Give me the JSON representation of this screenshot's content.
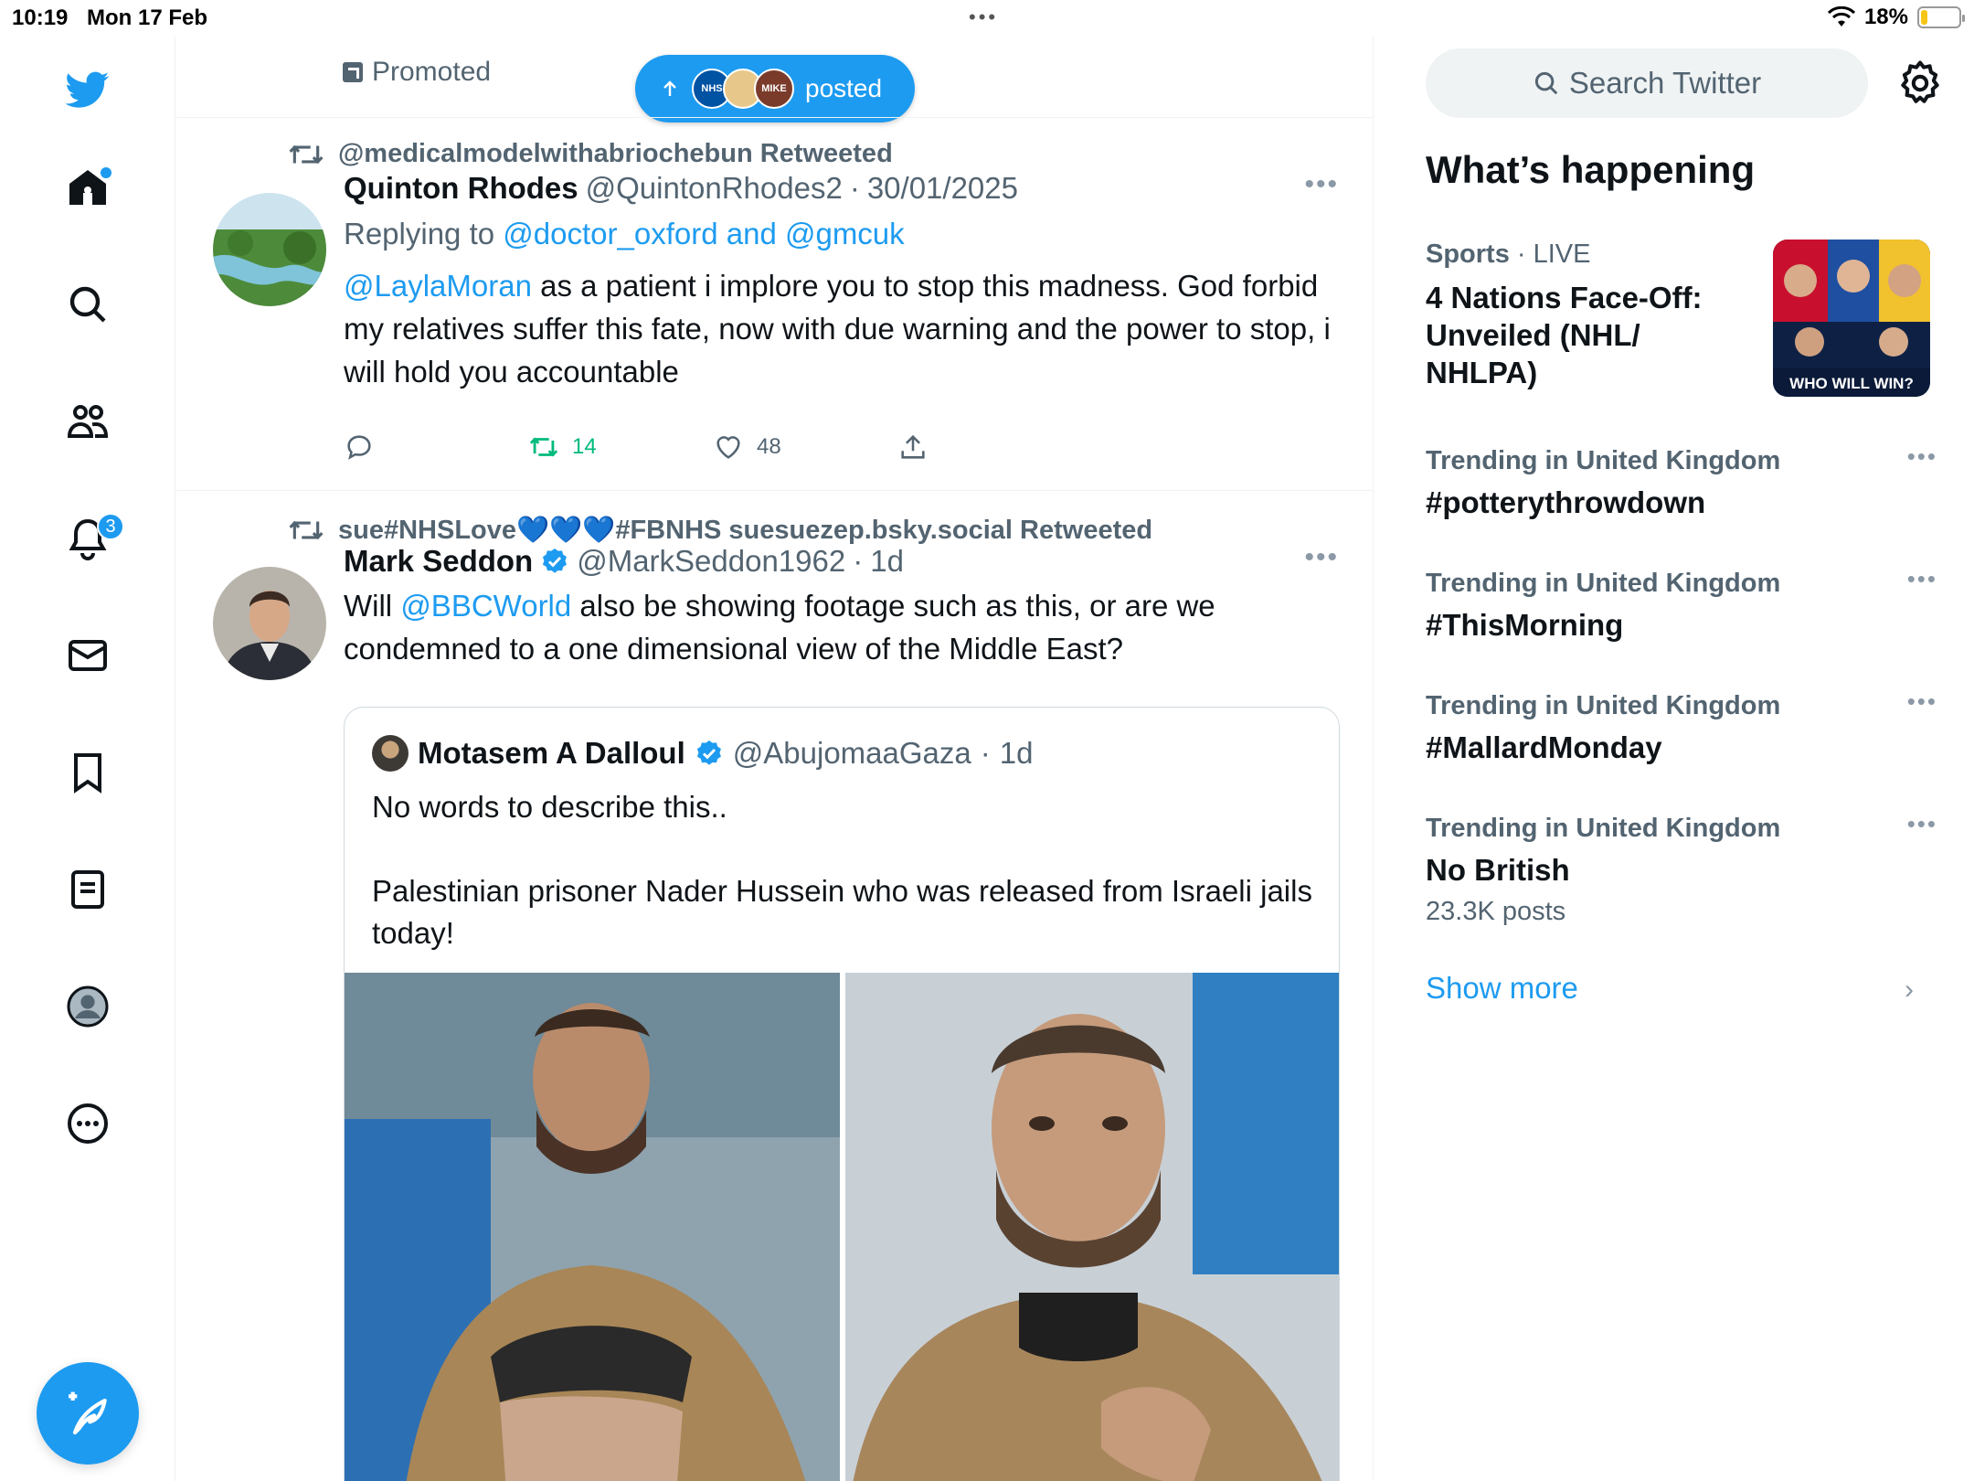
{
  "status_bar": {
    "time": "10:19",
    "date": "Mon 17 Feb",
    "battery": "18%",
    "battery_level": 0.18
  },
  "nav": {
    "notifications_badge": "3",
    "items": [
      "home-icon",
      "search-icon",
      "communities-icon",
      "notifications-icon",
      "messages-icon",
      "bookmarks-icon",
      "lists-icon",
      "profile-icon",
      "more-icon"
    ]
  },
  "timeline": {
    "promoted_label": "Promoted",
    "new_posts_pill": {
      "label": "posted",
      "avatar_labels": [
        "NHS",
        "",
        "MIKE"
      ]
    },
    "tweets": [
      {
        "retweeted_by": "@medicalmodelwithabriochebun Retweeted",
        "name": "Quinton Rhodes",
        "handle": "@QuintonRhodes2",
        "dot": "·",
        "date": "30/01/2025",
        "replying_prefix": "Replying to",
        "replying_to": "@doctor_oxford and @gmcuk",
        "mention": "@LaylaMoran",
        "text": " as a patient i implore you to stop this madness. God forbid my relatives suffer this fate, now with due warning and the power to stop, i will hold you accountable",
        "retweets": "14",
        "likes": "48"
      },
      {
        "retweeted_by": "sue#NHSLove💙💙💙#FBNHS suesuezep.bsky.social Retweeted",
        "name": "Mark Seddon",
        "handle": "@MarkSeddon1962",
        "dot": "·",
        "date": "1d",
        "text_prefix": "Will ",
        "mention": "@BBCWorld",
        "text": " also be showing footage such as this, or are we condemned to a one dimensional view of the Middle East?",
        "quote": {
          "name": "Motasem A Dalloul",
          "handle": "@AbujomaaGaza",
          "dot": "·",
          "date": "1d",
          "line1": "No words to describe this..",
          "line2": "Palestinian prisoner Nader Hussein who was released from Israeli jails today!"
        }
      }
    ]
  },
  "sidebar": {
    "search_placeholder": "Search Twitter",
    "section_title": "What’s happening",
    "sports": {
      "category": "Sports",
      "dot": " · ",
      "status": "LIVE",
      "title": "4 Nations Face-Off: Unveiled (NHL/ NHLPA)",
      "image_caption": "WHO WILL WIN?"
    },
    "trends": [
      {
        "context": "Trending in United Kingdom",
        "title": "#potterythrowdown",
        "count": ""
      },
      {
        "context": "Trending in United Kingdom",
        "title": "#ThisMorning",
        "count": ""
      },
      {
        "context": "Trending in United Kingdom",
        "title": "#MallardMonday",
        "count": ""
      },
      {
        "context": "Trending in United Kingdom",
        "title": "No British",
        "count": "23.3K posts"
      }
    ],
    "show_more": "Show more"
  },
  "colors": {
    "accent": "#1d9bf0",
    "retweet_green": "#00ba7c",
    "secondary_text": "#536471"
  }
}
